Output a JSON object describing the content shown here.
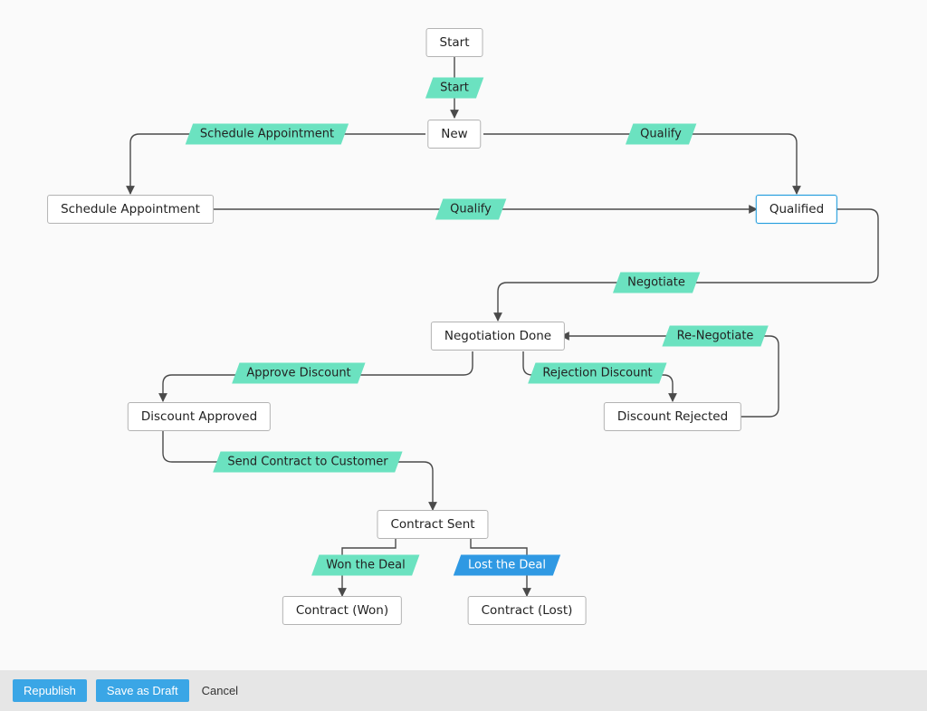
{
  "nodes": {
    "start": {
      "label": "Start"
    },
    "new": {
      "label": "New"
    },
    "sched": {
      "label": "Schedule Appointment"
    },
    "qual": {
      "label": "Qualified"
    },
    "neg": {
      "label": "Negotiation Done"
    },
    "dapp": {
      "label": "Discount Approved"
    },
    "drej": {
      "label": "Discount Rejected"
    },
    "csent": {
      "label": "Contract Sent"
    },
    "cwon": {
      "label": "Contract (Won)"
    },
    "clost": {
      "label": "Contract (Lost)"
    }
  },
  "edges": {
    "e_start": {
      "label": "Start"
    },
    "e_sched": {
      "label": "Schedule Appointment"
    },
    "e_qualify1": {
      "label": "Qualify"
    },
    "e_qualify2": {
      "label": "Qualify"
    },
    "e_negotiate": {
      "label": "Negotiate"
    },
    "e_approve": {
      "label": "Approve Discount"
    },
    "e_reject": {
      "label": "Rejection Discount"
    },
    "e_reneg": {
      "label": "Re-Negotiate"
    },
    "e_sendcontract": {
      "label": "Send Contract to Customer"
    },
    "e_won": {
      "label": "Won the Deal"
    },
    "e_lost": {
      "label": "Lost the Deal"
    }
  },
  "toolbar": {
    "republish": "Republish",
    "save_draft": "Save as Draft",
    "cancel": "Cancel"
  },
  "chart_data": {
    "type": "flowchart",
    "nodes": [
      {
        "id": "start",
        "label": "Start"
      },
      {
        "id": "new",
        "label": "New"
      },
      {
        "id": "sched",
        "label": "Schedule Appointment"
      },
      {
        "id": "qual",
        "label": "Qualified",
        "highlighted": true
      },
      {
        "id": "neg",
        "label": "Negotiation Done"
      },
      {
        "id": "dapp",
        "label": "Discount Approved"
      },
      {
        "id": "drej",
        "label": "Discount Rejected"
      },
      {
        "id": "csent",
        "label": "Contract Sent"
      },
      {
        "id": "cwon",
        "label": "Contract (Won)"
      },
      {
        "id": "clost",
        "label": "Contract (Lost)"
      }
    ],
    "edges": [
      {
        "from": "start",
        "to": "new",
        "label": "Start"
      },
      {
        "from": "new",
        "to": "sched",
        "label": "Schedule Appointment"
      },
      {
        "from": "new",
        "to": "qual",
        "label": "Qualify"
      },
      {
        "from": "sched",
        "to": "qual",
        "label": "Qualify"
      },
      {
        "from": "qual",
        "to": "neg",
        "label": "Negotiate"
      },
      {
        "from": "neg",
        "to": "dapp",
        "label": "Approve Discount"
      },
      {
        "from": "neg",
        "to": "drej",
        "label": "Rejection Discount"
      },
      {
        "from": "drej",
        "to": "neg",
        "label": "Re-Negotiate"
      },
      {
        "from": "dapp",
        "to": "csent",
        "label": "Send Contract to Customer"
      },
      {
        "from": "csent",
        "to": "cwon",
        "label": "Won the Deal"
      },
      {
        "from": "csent",
        "to": "clost",
        "label": "Lost the Deal",
        "style": "blue"
      }
    ]
  }
}
